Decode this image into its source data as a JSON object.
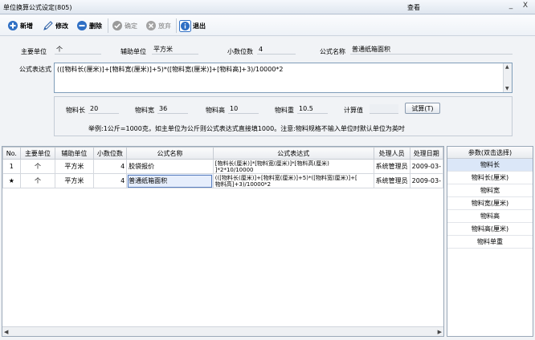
{
  "window": {
    "title": "单位换算公式设定(805)",
    "center_title": "查看",
    "controls": [
      "_",
      "X"
    ]
  },
  "toolbar": {
    "new_label": "新增",
    "edit_label": "修改",
    "delete_label": "删除",
    "confirm_label": "确定",
    "discard_label": "放弃",
    "exit_label": "退出"
  },
  "form": {
    "main_unit_label": "主要单位",
    "main_unit_value": "个",
    "aux_unit_label": "辅助单位",
    "aux_unit_value": "平方米",
    "decimals_label": "小数位数",
    "decimals_value": "4",
    "formula_name_label": "公式名称",
    "formula_name_value": "普通纸箱面积",
    "formula_expr_label": "公式表达式",
    "formula_expr_value": "(([物料长(厘米)]+[物料宽(厘米)]+5)*([物料宽(厘米)]+[物料高]+3)/10000*2"
  },
  "test": {
    "length_label": "物料长",
    "length_value": "20",
    "width_label": "物料宽",
    "width_value": "36",
    "height_label": "物料高",
    "height_value": "10",
    "weight_label": "物料重",
    "weight_value": "10.5",
    "calc_label": "计算值",
    "calc_value": "",
    "test_button": "试算(T)",
    "example": "举例:1公斤=1000克，如主单位为公斤则公式表达式直接填1000。注意:物料规格不输入单位时默认单位为英吋"
  },
  "grid": {
    "columns": [
      "No.",
      "主要单位",
      "辅助单位",
      "小数位数",
      "公式名称",
      "公式表达式",
      "处理人员",
      "处理日期"
    ],
    "rows": [
      {
        "no": "1",
        "main_unit": "个",
        "aux_unit": "平方米",
        "decimals": "4",
        "name": "胶袋报价",
        "expr_line1": "[物料长(厘米)]*[物料宽(厘米)]*[物料高(厘米)",
        "expr_line2": "]*2*10/10000",
        "operator": "系统管理员",
        "date": "2009-03-"
      },
      {
        "no": "★",
        "main_unit": "个",
        "aux_unit": "平方米",
        "decimals": "4",
        "name": "普通纸箱面积",
        "expr_line1": "(([物料长(厘米)]+[物料宽(厘米)]+5)*([物料宽(厘米)]+[",
        "expr_line2": "物料高]+3)/10000*2",
        "operator": "系统管理员",
        "date": "2009-03-"
      }
    ]
  },
  "params": {
    "header": "参数(双击选择)",
    "items": [
      "物料长",
      "物料长(厘米)",
      "物料宽",
      "物料宽(厘米)",
      "物料高",
      "物料高(厘米)",
      "物料单重"
    ],
    "selected_index": 0
  }
}
